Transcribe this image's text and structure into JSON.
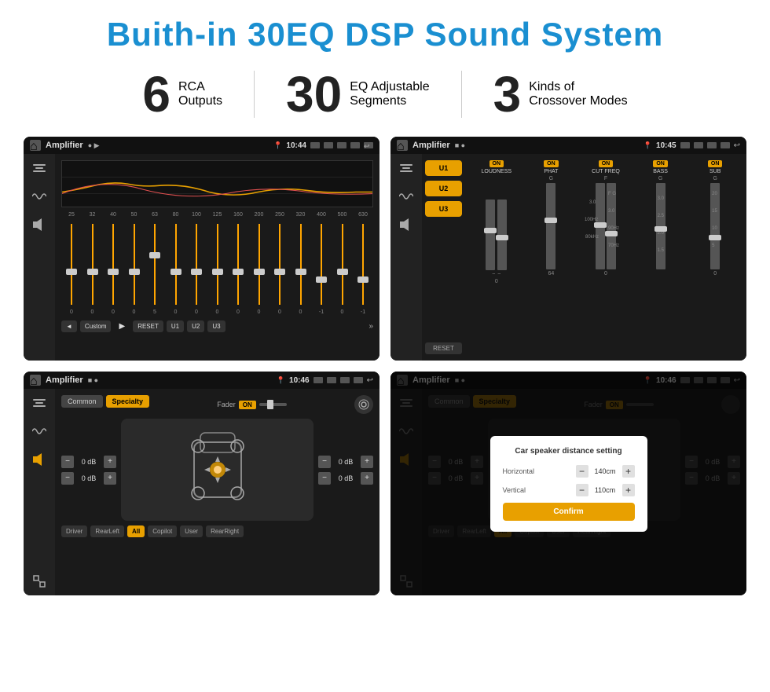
{
  "title": "Buith-in 30EQ DSP Sound System",
  "stats": [
    {
      "number": "6",
      "text_line1": "RCA",
      "text_line2": "Outputs"
    },
    {
      "number": "30",
      "text_line1": "EQ Adjustable",
      "text_line2": "Segments"
    },
    {
      "number": "3",
      "text_line1": "Kinds of",
      "text_line2": "Crossover Modes"
    }
  ],
  "screens": [
    {
      "id": "eq-screen",
      "status_bar": {
        "app": "Amplifier",
        "time": "10:44",
        "dots": "● ▶"
      },
      "type": "eq"
    },
    {
      "id": "crossover-screen",
      "status_bar": {
        "app": "Amplifier",
        "time": "10:45",
        "dots": "■ ●"
      },
      "type": "crossover"
    },
    {
      "id": "speaker-screen",
      "status_bar": {
        "app": "Amplifier",
        "time": "10:46",
        "dots": "■ ●"
      },
      "type": "speaker"
    },
    {
      "id": "speaker-modal-screen",
      "status_bar": {
        "app": "Amplifier",
        "time": "10:46",
        "dots": "■ ●"
      },
      "type": "speaker-modal"
    }
  ],
  "eq": {
    "frequencies": [
      "25",
      "32",
      "40",
      "50",
      "63",
      "80",
      "100",
      "125",
      "160",
      "200",
      "250",
      "320",
      "400",
      "500",
      "630"
    ],
    "values": [
      "0",
      "0",
      "0",
      "0",
      "5",
      "0",
      "0",
      "0",
      "0",
      "0",
      "0",
      "0",
      "-1",
      "0",
      "-1"
    ],
    "controls": {
      "prev": "◄",
      "preset": "Custom",
      "play": "▶",
      "reset": "RESET",
      "u1": "U1",
      "u2": "U2",
      "u3": "U3"
    }
  },
  "crossover": {
    "presets": [
      "U1",
      "U2",
      "U3"
    ],
    "channels": [
      "LOUDNESS",
      "PHAT",
      "CUT FREQ",
      "BASS",
      "SUB"
    ],
    "on_label": "ON",
    "reset_label": "RESET"
  },
  "speaker": {
    "tabs": [
      "Common",
      "Specialty"
    ],
    "fader_label": "Fader",
    "on_label": "ON",
    "db_values": [
      "0 dB",
      "0 dB",
      "0 dB",
      "0 dB"
    ],
    "buttons": [
      "Driver",
      "RearLeft",
      "All",
      "Copilot",
      "User",
      "RearRight"
    ]
  },
  "modal": {
    "title": "Car speaker distance setting",
    "horizontal_label": "Horizontal",
    "horizontal_value": "140cm",
    "vertical_label": "Vertical",
    "vertical_value": "110cm",
    "confirm_label": "Confirm"
  },
  "colors": {
    "accent": "#e8a000",
    "blue": "#1a8fd1",
    "dark_bg": "#1a1a1a"
  }
}
